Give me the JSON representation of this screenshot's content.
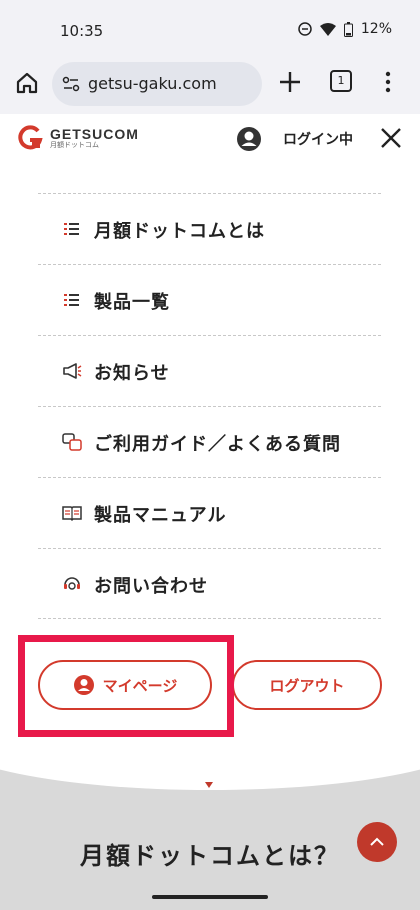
{
  "status": {
    "time": "10:35",
    "battery": "12%"
  },
  "browser": {
    "url": "getsu-gaku.com",
    "tab_count": "1"
  },
  "site": {
    "logo_main": "GETSUCOM",
    "logo_sub": "月額ドットコム",
    "login_status": "ログイン中"
  },
  "menu": {
    "items": [
      {
        "label": "月額ドットコムとは",
        "icon": "list-icon"
      },
      {
        "label": "製品一覧",
        "icon": "list-icon"
      },
      {
        "label": "お知らせ",
        "icon": "megaphone-icon"
      },
      {
        "label": "ご利用ガイド／よくある質問",
        "icon": "qa-icon"
      },
      {
        "label": "製品マニュアル",
        "icon": "book-icon"
      },
      {
        "label": "お問い合わせ",
        "icon": "headset-icon"
      }
    ],
    "mypage_label": "マイページ",
    "logout_label": "ログアウト"
  },
  "background": {
    "section_title": "月額ドットコムとは？"
  },
  "colors": {
    "accent": "#d33a2c",
    "highlight": "#e8194a"
  }
}
